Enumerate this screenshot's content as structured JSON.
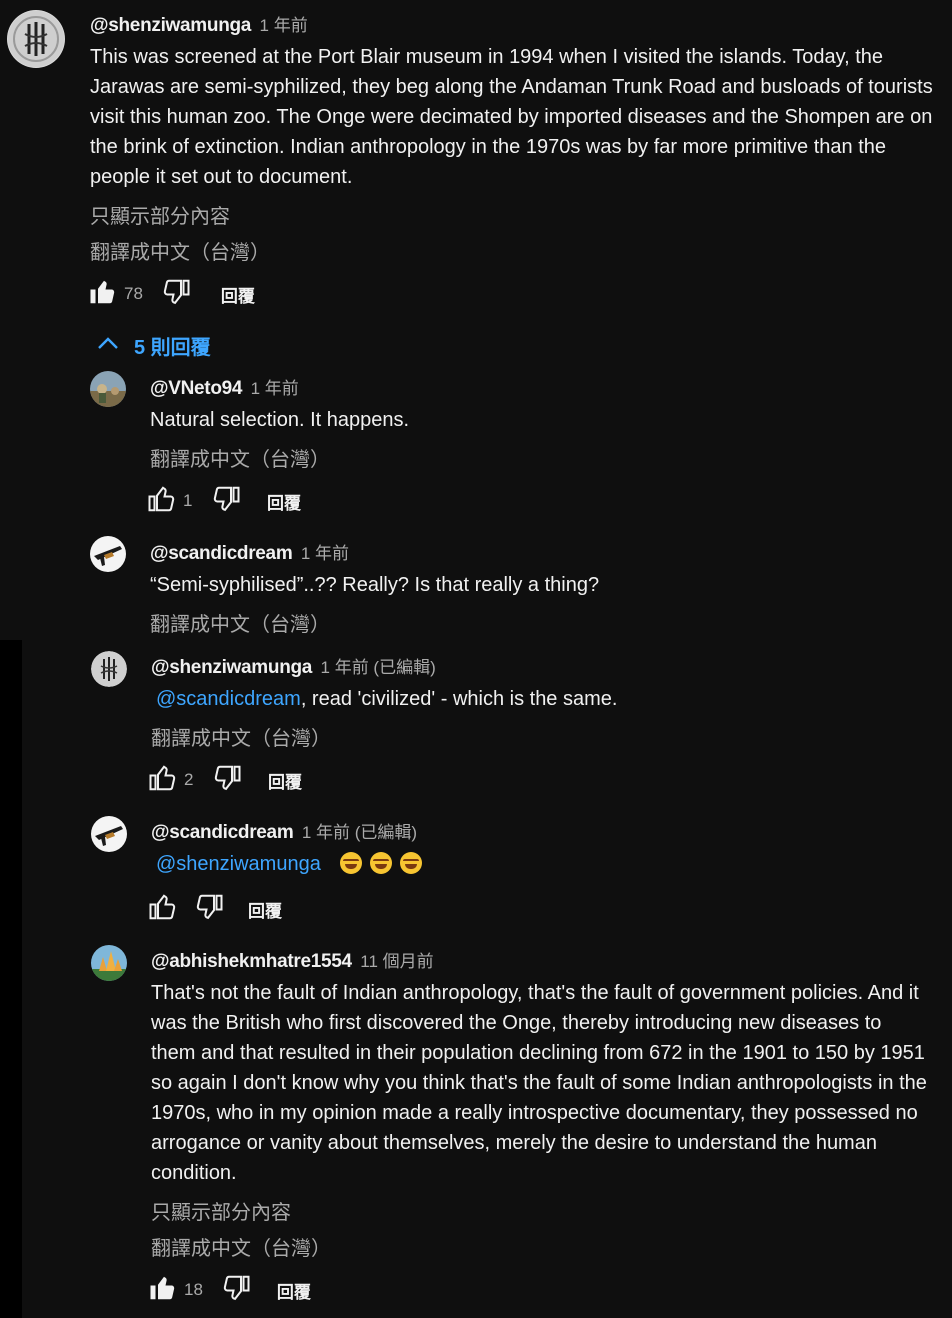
{
  "main_comment": {
    "author": "@shenziwamunga",
    "time": "1 年前",
    "text": "This was screened at the Port Blair museum in 1994 when I visited the islands. Today, the Jarawas are semi-syphilized, they beg along the Andaman Trunk Road and busloads of tourists visit this human zoo. The Onge were decimated by imported diseases and the Shompen are on the brink of extinction. Indian anthropology in the 1970s was by far more primitive than the people it set out to document.",
    "show_less": "只顯示部分內容",
    "translate": "翻譯成中文（台灣）",
    "likes": "78",
    "reply_label": "回覆"
  },
  "replies_toggle": "5 則回覆",
  "replies": [
    {
      "author": "@VNeto94",
      "time": "1 年前",
      "text": "Natural selection. It happens.",
      "translate": "翻譯成中文（台灣）",
      "likes": "1",
      "reply_label": "回覆"
    },
    {
      "author": "@scandicdream",
      "time": "1 年前",
      "text": "“Semi-syphilised”..?? Really? Is that really a thing?",
      "translate": "翻譯成中文（台灣）"
    },
    {
      "author": "@shenziwamunga",
      "time": "1 年前 (已編輯)",
      "mention": "@scandicdream",
      "text": ", read 'civilized' - which is the same.",
      "translate": "翻譯成中文（台灣）",
      "likes": "2",
      "reply_label": "回覆"
    },
    {
      "author": "@scandicdream",
      "time": "1 年前 (已編輯)",
      "mention": "@shenziwamunga",
      "emojis": "😂😂😂",
      "reply_label": "回覆"
    },
    {
      "author": "@abhishekmhatre1554",
      "time": "11 個月前",
      "text": "That's not the fault of Indian anthropology, that's the fault of government policies. And it was the British who first discovered the Onge, thereby introducing new diseases to them and that resulted in their population declining from 672 in the 1901 to 150 by 1951 so again I don't know why you think that's the fault of some Indian anthropologists in the 1970s,  who in my opinion made a really introspective documentary, they possessed no arrogance or vanity about themselves, merely the desire to understand the human condition.",
      "show_less": "只顯示部分內容",
      "translate": "翻譯成中文（台灣）",
      "likes": "18",
      "reply_label": "回覆"
    }
  ],
  "colors": {
    "background": "#0f0f0f",
    "link": "#3ea6ff",
    "muted": "#aaaaaa"
  },
  "icons": [
    "like-icon",
    "dislike-icon",
    "chevron-up-icon",
    "avatar-seal",
    "avatar-landscape",
    "avatar-rifle",
    "avatar-temple",
    "emoji-laugh-icon"
  ]
}
